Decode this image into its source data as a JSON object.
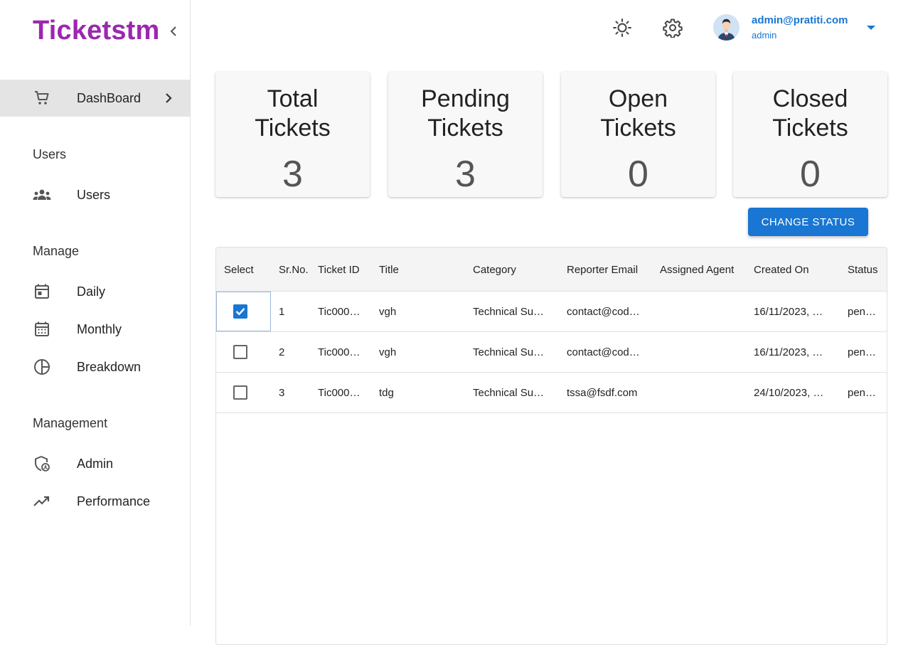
{
  "brand": {
    "name": "Ticketstm"
  },
  "sidebar": {
    "dashboard": {
      "label": "DashBoard"
    },
    "sections": [
      {
        "title": "Users",
        "items": [
          {
            "label": "Users",
            "icon": "users-icon"
          }
        ]
      },
      {
        "title": "Manage",
        "items": [
          {
            "label": "Daily",
            "icon": "calendar-today-icon"
          },
          {
            "label": "Monthly",
            "icon": "calendar-month-icon"
          },
          {
            "label": "Breakdown",
            "icon": "pie-chart-icon"
          }
        ]
      },
      {
        "title": "Management",
        "items": [
          {
            "label": "Admin",
            "icon": "admin-shield-icon"
          },
          {
            "label": "Performance",
            "icon": "trending-up-icon"
          }
        ]
      }
    ]
  },
  "user": {
    "email": "admin@pratiti.com",
    "role": "admin"
  },
  "cards": [
    {
      "line1": "Total",
      "line2": "Tickets",
      "value": "3"
    },
    {
      "line1": "Pending",
      "line2": "Tickets",
      "value": "3"
    },
    {
      "line1": "Open",
      "line2": "Tickets",
      "value": "0"
    },
    {
      "line1": "Closed",
      "line2": "Tickets",
      "value": "0"
    }
  ],
  "actions": {
    "change_status": "CHANGE STATUS"
  },
  "table": {
    "columns": [
      "Select",
      "Sr.No.",
      "Ticket ID",
      "Title",
      "Category",
      "Reporter Email",
      "Assigned Agent",
      "Created On",
      "Status"
    ],
    "rows": [
      {
        "selected": true,
        "sr": "1",
        "ticket_id": "Tic000…",
        "title": "vgh",
        "category": "Technical Su…",
        "email": "contact@cod…",
        "agent": "",
        "created": "16/11/2023, …",
        "status": "pen…"
      },
      {
        "selected": false,
        "sr": "2",
        "ticket_id": "Tic000…",
        "title": "vgh",
        "category": "Technical Su…",
        "email": "contact@cod…",
        "agent": "",
        "created": "16/11/2023, …",
        "status": "pen…"
      },
      {
        "selected": false,
        "sr": "3",
        "ticket_id": "Tic000…",
        "title": "tdg",
        "category": "Technical Su…",
        "email": "tssa@fsdf.com",
        "agent": "",
        "created": "24/10/2023, …",
        "status": "pen…"
      }
    ]
  },
  "colors": {
    "brand": "#9c27b0",
    "primary": "#1976d2",
    "active_nav": "#e4e4e4"
  }
}
